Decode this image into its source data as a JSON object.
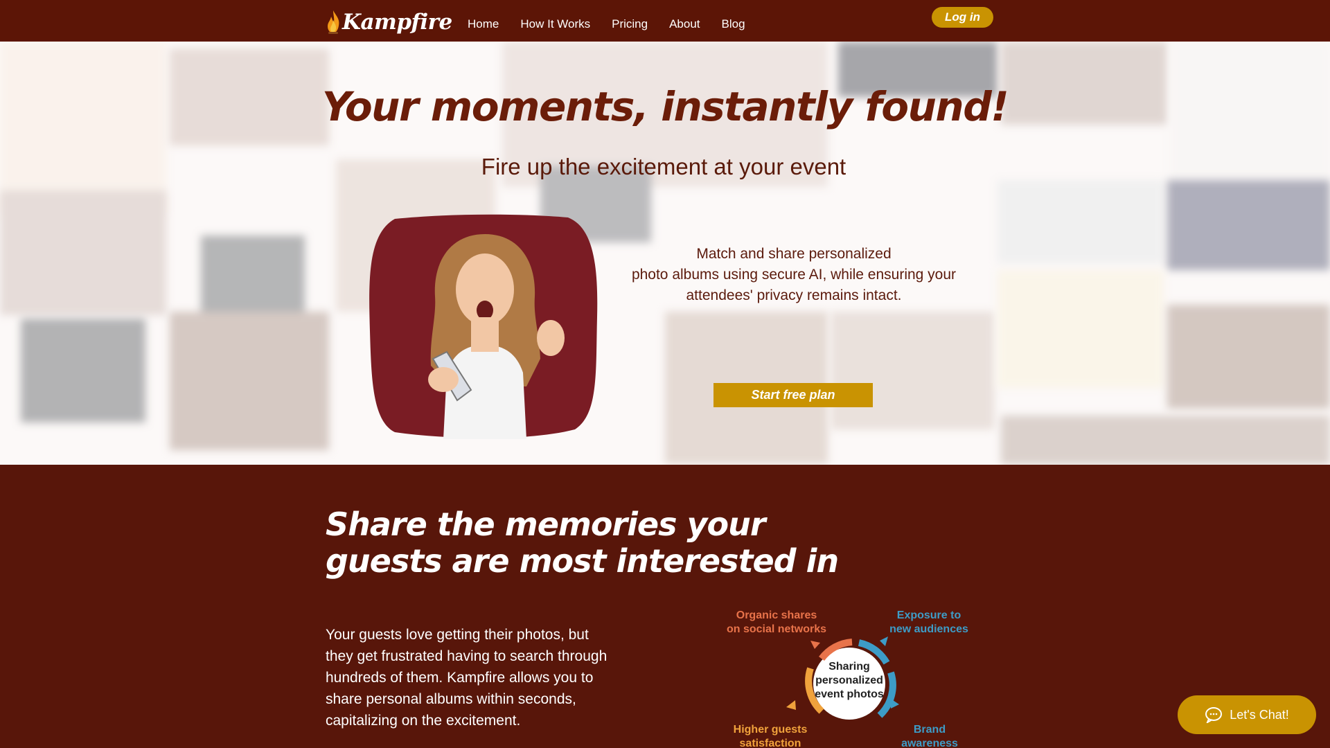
{
  "nav": {
    "logo_text": "Kampfire",
    "links": [
      "Home",
      "How It Works",
      "Pricing",
      "About",
      "Blog"
    ],
    "login_label": "Log in"
  },
  "hero": {
    "title": "Your moments, instantly found!",
    "subtitle": "Fire up the excitement at your event",
    "description_lines": [
      "Match and share personalized",
      "photo albums using secure AI, while ensuring your",
      "attendees' privacy remains intact."
    ],
    "cta_label": "Start free plan"
  },
  "section2": {
    "title_lines": [
      "Share the memories your",
      "guests are most interested in"
    ],
    "body_lines": [
      "Your guests love getting their photos, but",
      "they get frustrated having to search through",
      "hundreds of them. Kampfire allows you to",
      "share personal albums within seconds,",
      "capitalizing on the excitement."
    ],
    "diagram": {
      "center_lines": [
        "Sharing",
        "personalized",
        "event photos"
      ],
      "top_left_lines": [
        "Organic shares",
        "on social networks"
      ],
      "top_right_lines": [
        "Exposure to",
        "new audiences"
      ],
      "bottom_left_lines": [
        "Higher guests",
        "satisfaction"
      ],
      "bottom_right_lines": [
        "Brand",
        "awareness"
      ],
      "colors": {
        "orange": "#e8734a",
        "blue": "#3d9cc7",
        "yellow": "#f0a23c"
      }
    }
  },
  "chat": {
    "label": "Let's Chat!"
  },
  "colors": {
    "brand_dark": "#5c1506",
    "accent": "#c99302",
    "hero_text": "#6b1d09"
  }
}
